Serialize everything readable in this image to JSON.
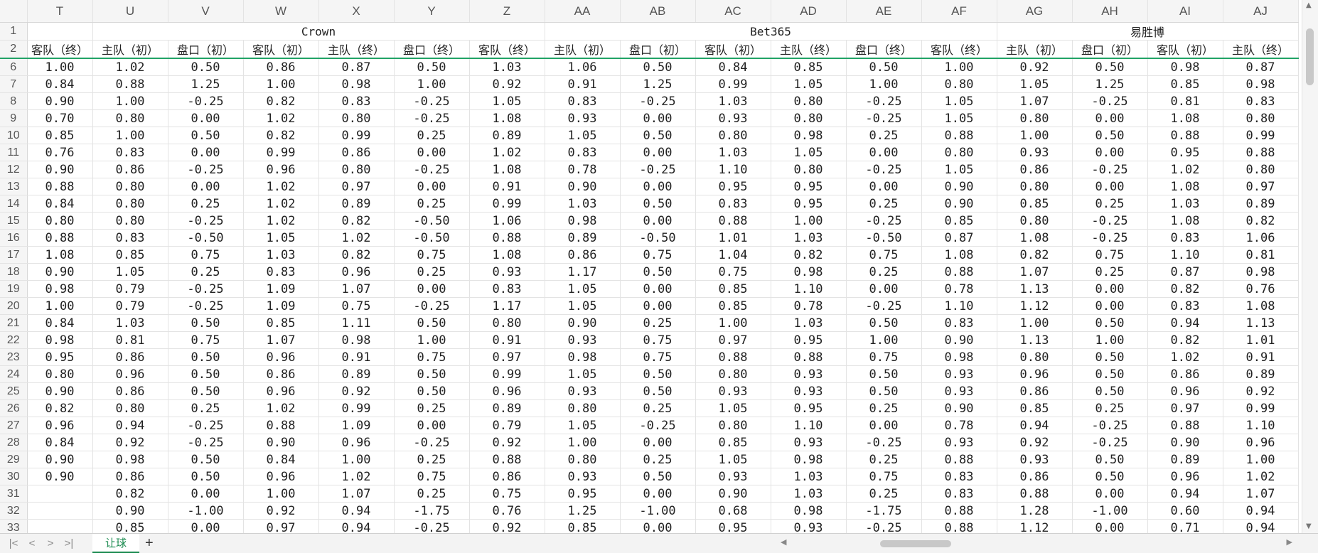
{
  "columns": [
    "T",
    "U",
    "V",
    "W",
    "X",
    "Y",
    "Z",
    "AA",
    "AB",
    "AC",
    "AD",
    "AE",
    "AF",
    "AG",
    "AH",
    "AI",
    "AJ"
  ],
  "groups": {
    "crown": "Crown",
    "bet365": "Bet365",
    "ysb": "易胜博"
  },
  "header_row": [
    "客队（终）",
    "主队（初）",
    "盘口（初）",
    "客队（初）",
    "主队（终）",
    "盘口（终）",
    "客队（终）",
    "主队（初）",
    "盘口（初）",
    "客队（初）",
    "主队（终）",
    "盘口（终）",
    "客队（终）",
    "主队（初）",
    "盘口（初）",
    "客队（初）",
    "主队（终）"
  ],
  "rows": [
    {
      "n": "6",
      "c": [
        "1.00",
        "1.02",
        "0.50",
        "0.86",
        "0.87",
        "0.50",
        "1.03",
        "1.06",
        "0.50",
        "0.84",
        "0.85",
        "0.50",
        "1.00",
        "0.92",
        "0.50",
        "0.98",
        "0.87"
      ]
    },
    {
      "n": "7",
      "c": [
        "0.84",
        "0.88",
        "1.25",
        "1.00",
        "0.98",
        "1.00",
        "0.92",
        "0.91",
        "1.25",
        "0.99",
        "1.05",
        "1.00",
        "0.80",
        "1.05",
        "1.25",
        "0.85",
        "0.98"
      ]
    },
    {
      "n": "8",
      "c": [
        "0.90",
        "1.00",
        "-0.25",
        "0.82",
        "0.83",
        "-0.25",
        "1.05",
        "0.83",
        "-0.25",
        "1.03",
        "0.80",
        "-0.25",
        "1.05",
        "1.07",
        "-0.25",
        "0.81",
        "0.83"
      ]
    },
    {
      "n": "9",
      "c": [
        "0.70",
        "0.80",
        "0.00",
        "1.02",
        "0.80",
        "-0.25",
        "1.08",
        "0.93",
        "0.00",
        "0.93",
        "0.80",
        "-0.25",
        "1.05",
        "0.80",
        "0.00",
        "1.08",
        "0.80"
      ]
    },
    {
      "n": "10",
      "c": [
        "0.85",
        "1.00",
        "0.50",
        "0.82",
        "0.99",
        "0.25",
        "0.89",
        "1.05",
        "0.50",
        "0.80",
        "0.98",
        "0.25",
        "0.88",
        "1.00",
        "0.50",
        "0.88",
        "0.99"
      ]
    },
    {
      "n": "11",
      "c": [
        "0.76",
        "0.83",
        "0.00",
        "0.99",
        "0.86",
        "0.00",
        "1.02",
        "0.83",
        "0.00",
        "1.03",
        "1.05",
        "0.00",
        "0.80",
        "0.93",
        "0.00",
        "0.95",
        "0.88"
      ]
    },
    {
      "n": "12",
      "c": [
        "0.90",
        "0.86",
        "-0.25",
        "0.96",
        "0.80",
        "-0.25",
        "1.08",
        "0.78",
        "-0.25",
        "1.10",
        "0.80",
        "-0.25",
        "1.05",
        "0.86",
        "-0.25",
        "1.02",
        "0.80"
      ]
    },
    {
      "n": "13",
      "c": [
        "0.88",
        "0.80",
        "0.00",
        "1.02",
        "0.97",
        "0.00",
        "0.91",
        "0.90",
        "0.00",
        "0.95",
        "0.95",
        "0.00",
        "0.90",
        "0.80",
        "0.00",
        "1.08",
        "0.97"
      ]
    },
    {
      "n": "14",
      "c": [
        "0.84",
        "0.80",
        "0.25",
        "1.02",
        "0.89",
        "0.25",
        "0.99",
        "1.03",
        "0.50",
        "0.83",
        "0.95",
        "0.25",
        "0.90",
        "0.85",
        "0.25",
        "1.03",
        "0.89"
      ]
    },
    {
      "n": "15",
      "c": [
        "0.80",
        "0.80",
        "-0.25",
        "1.02",
        "0.82",
        "-0.50",
        "1.06",
        "0.98",
        "0.00",
        "0.88",
        "1.00",
        "-0.25",
        "0.85",
        "0.80",
        "-0.25",
        "1.08",
        "0.82"
      ]
    },
    {
      "n": "16",
      "c": [
        "0.88",
        "0.83",
        "-0.50",
        "1.05",
        "1.02",
        "-0.50",
        "0.88",
        "0.89",
        "-0.50",
        "1.01",
        "1.03",
        "-0.50",
        "0.87",
        "1.08",
        "-0.25",
        "0.83",
        "1.06"
      ]
    },
    {
      "n": "17",
      "c": [
        "1.08",
        "0.85",
        "0.75",
        "1.03",
        "0.82",
        "0.75",
        "1.08",
        "0.86",
        "0.75",
        "1.04",
        "0.82",
        "0.75",
        "1.08",
        "0.82",
        "0.75",
        "1.10",
        "0.81"
      ]
    },
    {
      "n": "18",
      "c": [
        "0.90",
        "1.05",
        "0.25",
        "0.83",
        "0.96",
        "0.25",
        "0.93",
        "1.17",
        "0.50",
        "0.75",
        "0.98",
        "0.25",
        "0.88",
        "1.07",
        "0.25",
        "0.87",
        "0.98"
      ]
    },
    {
      "n": "19",
      "c": [
        "0.98",
        "0.79",
        "-0.25",
        "1.09",
        "1.07",
        "0.00",
        "0.83",
        "1.05",
        "0.00",
        "0.85",
        "1.10",
        "0.00",
        "0.78",
        "1.13",
        "0.00",
        "0.82",
        "0.76"
      ]
    },
    {
      "n": "20",
      "c": [
        "1.00",
        "0.79",
        "-0.25",
        "1.09",
        "0.75",
        "-0.25",
        "1.17",
        "1.05",
        "0.00",
        "0.85",
        "0.78",
        "-0.25",
        "1.10",
        "1.12",
        "0.00",
        "0.83",
        "1.08"
      ]
    },
    {
      "n": "21",
      "c": [
        "0.84",
        "1.03",
        "0.50",
        "0.85",
        "1.11",
        "0.50",
        "0.80",
        "0.90",
        "0.25",
        "1.00",
        "1.03",
        "0.50",
        "0.83",
        "1.00",
        "0.50",
        "0.94",
        "1.13"
      ]
    },
    {
      "n": "22",
      "c": [
        "0.98",
        "0.81",
        "0.75",
        "1.07",
        "0.98",
        "1.00",
        "0.91",
        "0.93",
        "0.75",
        "0.97",
        "0.95",
        "1.00",
        "0.90",
        "1.13",
        "1.00",
        "0.82",
        "1.01"
      ]
    },
    {
      "n": "23",
      "c": [
        "0.95",
        "0.86",
        "0.50",
        "0.96",
        "0.91",
        "0.75",
        "0.97",
        "0.98",
        "0.75",
        "0.88",
        "0.88",
        "0.75",
        "0.98",
        "0.80",
        "0.50",
        "1.02",
        "0.91"
      ]
    },
    {
      "n": "24",
      "c": [
        "0.80",
        "0.96",
        "0.50",
        "0.86",
        "0.89",
        "0.50",
        "0.99",
        "1.05",
        "0.50",
        "0.80",
        "0.93",
        "0.50",
        "0.93",
        "0.96",
        "0.50",
        "0.86",
        "0.89"
      ]
    },
    {
      "n": "25",
      "c": [
        "0.90",
        "0.86",
        "0.50",
        "0.96",
        "0.92",
        "0.50",
        "0.96",
        "0.93",
        "0.50",
        "0.93",
        "0.93",
        "0.50",
        "0.93",
        "0.86",
        "0.50",
        "0.96",
        "0.92"
      ]
    },
    {
      "n": "26",
      "c": [
        "0.82",
        "0.80",
        "0.25",
        "1.02",
        "0.99",
        "0.25",
        "0.89",
        "0.80",
        "0.25",
        "1.05",
        "0.95",
        "0.25",
        "0.90",
        "0.85",
        "0.25",
        "0.97",
        "0.99"
      ]
    },
    {
      "n": "27",
      "c": [
        "0.96",
        "0.94",
        "-0.25",
        "0.88",
        "1.09",
        "0.00",
        "0.79",
        "1.05",
        "-0.25",
        "0.80",
        "1.10",
        "0.00",
        "0.78",
        "0.94",
        "-0.25",
        "0.88",
        "1.10"
      ]
    },
    {
      "n": "28",
      "c": [
        "0.84",
        "0.92",
        "-0.25",
        "0.90",
        "0.96",
        "-0.25",
        "0.92",
        "1.00",
        "0.00",
        "0.85",
        "0.93",
        "-0.25",
        "0.93",
        "0.92",
        "-0.25",
        "0.90",
        "0.96"
      ]
    },
    {
      "n": "29",
      "c": [
        "0.90",
        "0.98",
        "0.50",
        "0.84",
        "1.00",
        "0.25",
        "0.88",
        "0.80",
        "0.25",
        "1.05",
        "0.98",
        "0.25",
        "0.88",
        "0.93",
        "0.50",
        "0.89",
        "1.00"
      ]
    },
    {
      "n": "30",
      "c": [
        "0.90",
        "0.86",
        "0.50",
        "0.96",
        "1.02",
        "0.75",
        "0.86",
        "0.93",
        "0.50",
        "0.93",
        "1.03",
        "0.75",
        "0.83",
        "0.86",
        "0.50",
        "0.96",
        "1.02"
      ]
    },
    {
      "n": "31",
      "c": [
        "",
        "0.82",
        "0.00",
        "1.00",
        "1.07",
        "0.25",
        "0.75",
        "0.95",
        "0.00",
        "0.90",
        "1.03",
        "0.25",
        "0.83",
        "0.88",
        "0.00",
        "0.94",
        "1.07"
      ]
    },
    {
      "n": "32",
      "c": [
        "",
        "0.90",
        "-1.00",
        "0.92",
        "0.94",
        "-1.75",
        "0.76",
        "1.25",
        "-1.00",
        "0.68",
        "0.98",
        "-1.75",
        "0.88",
        "1.28",
        "-1.00",
        "0.60",
        "0.94"
      ]
    },
    {
      "n": "33",
      "c": [
        "",
        "0.85",
        "0.00",
        "0.97",
        "0.94",
        "-0.25",
        "0.92",
        "0.85",
        "0.00",
        "0.95",
        "0.93",
        "-0.25",
        "0.88",
        "1.12",
        "0.00",
        "0.71",
        "0.94"
      ]
    }
  ],
  "sheet_tab": "让球",
  "icons": {
    "first": "first-sheet-icon",
    "prev": "prev-sheet-icon",
    "next": "next-sheet-icon",
    "last": "last-sheet-icon",
    "add": "add-sheet-icon"
  }
}
